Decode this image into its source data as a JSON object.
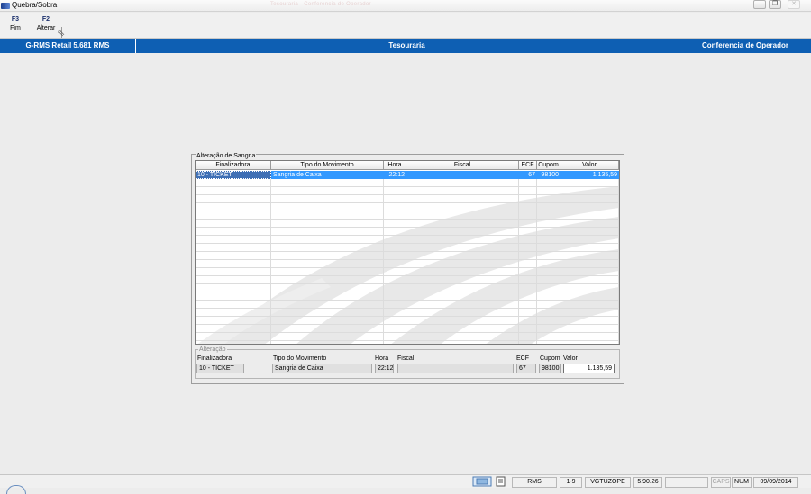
{
  "window": {
    "title": "Quebra/Sobra",
    "title_ghost": "Tesouraria · Conferencia de Operador"
  },
  "toolbar": {
    "buttons": [
      {
        "key": "F3",
        "label": "Fim"
      },
      {
        "key": "F2",
        "label": "Alterar"
      }
    ]
  },
  "header": {
    "left": "G-RMS Retail 5.681 RMS",
    "center": "Tesouraria",
    "right": "Conferencia de Operador"
  },
  "panel": {
    "title": "Alteração de Sangria",
    "columns": [
      "Finalizadora",
      "Tipo do Movimento",
      "Hora",
      "Fiscal",
      "ECF",
      "Cupom",
      "Valor"
    ],
    "rows": [
      {
        "finalizadora": "10 - TICKET",
        "tipo": "Sangria de Caixa",
        "hora": "22:12",
        "fiscal": "",
        "ecf": "67",
        "cupom": "98100",
        "valor": "1.135,59"
      }
    ]
  },
  "alteracao": {
    "title": "Alteração",
    "labels": {
      "finalizadora": "Finalizadora",
      "tipo": "Tipo do Movimento",
      "hora": "Hora",
      "fiscal": "Fiscal",
      "ecf": "ECF",
      "cupom": "Cupom",
      "valor": "Valor"
    },
    "values": {
      "finalizadora": "10 - TICKET",
      "tipo": "Sangria de Caixa",
      "hora": "22:12",
      "fiscal": "",
      "ecf": "67",
      "cupom": "98100",
      "valor": "1.135,59"
    }
  },
  "statusbar": {
    "cells": [
      "RMS",
      "1-9",
      "VGTUZOPE",
      "5.90.26",
      "",
      "CAPS",
      "NUM",
      "09/09/2014"
    ]
  }
}
